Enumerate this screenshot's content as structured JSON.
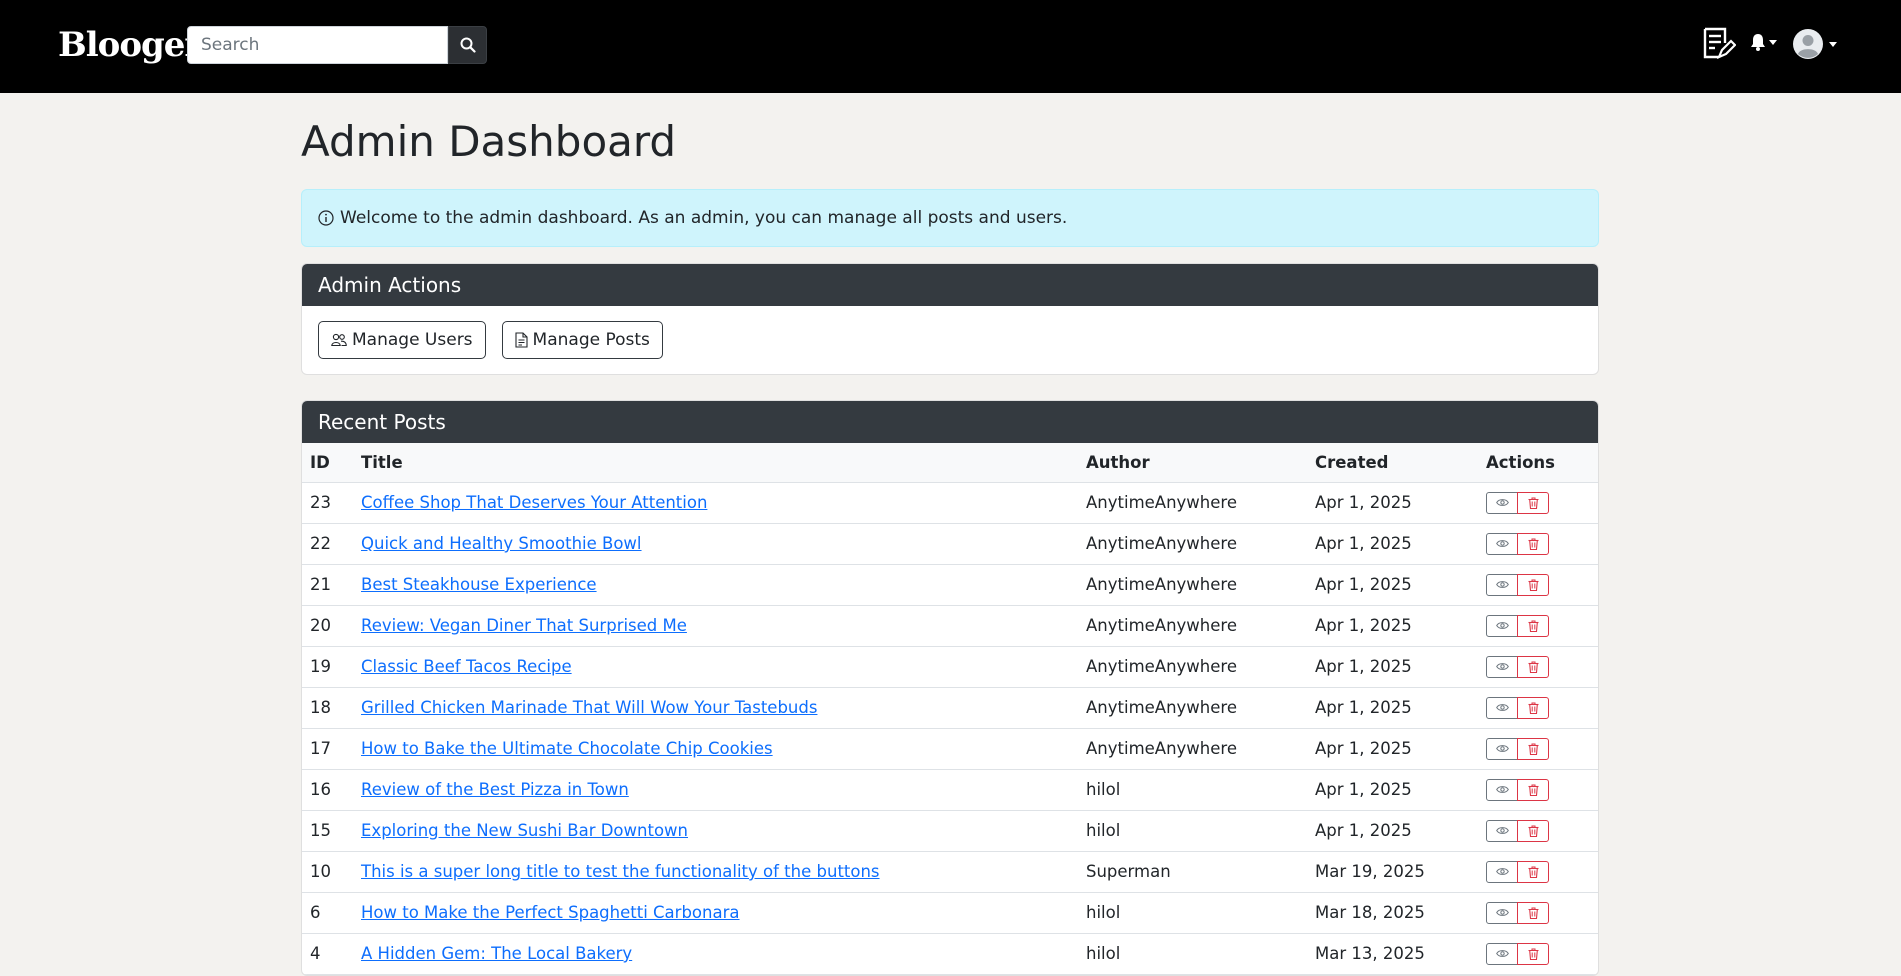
{
  "navbar": {
    "brand": "Blooger.",
    "search_placeholder": "Search",
    "icons": {
      "search": "search-icon",
      "write": "write-post-icon",
      "bell": "bell-icon",
      "avatar": "avatar-icon"
    }
  },
  "page": {
    "title": "Admin Dashboard",
    "alert_text": "Welcome to the admin dashboard. As an admin, you can manage all posts and users."
  },
  "admin_actions": {
    "header": "Admin Actions",
    "manage_users": "Manage Users",
    "manage_posts": "Manage Posts"
  },
  "recent_posts": {
    "header": "Recent Posts",
    "columns": [
      "ID",
      "Title",
      "Author",
      "Created",
      "Actions"
    ],
    "rows": [
      {
        "id": "23",
        "title": "Coffee Shop That Deserves Your Attention",
        "author": "AnytimeAnywhere",
        "created": "Apr 1, 2025"
      },
      {
        "id": "22",
        "title": "Quick and Healthy Smoothie Bowl",
        "author": "AnytimeAnywhere",
        "created": "Apr 1, 2025"
      },
      {
        "id": "21",
        "title": "Best Steakhouse Experience",
        "author": "AnytimeAnywhere",
        "created": "Apr 1, 2025"
      },
      {
        "id": "20",
        "title": "Review: Vegan Diner That Surprised Me",
        "author": "AnytimeAnywhere",
        "created": "Apr 1, 2025"
      },
      {
        "id": "19",
        "title": "Classic Beef Tacos Recipe",
        "author": "AnytimeAnywhere",
        "created": "Apr 1, 2025"
      },
      {
        "id": "18",
        "title": "Grilled Chicken Marinade That Will Wow Your Tastebuds",
        "author": "AnytimeAnywhere",
        "created": "Apr 1, 2025"
      },
      {
        "id": "17",
        "title": "How to Bake the Ultimate Chocolate Chip Cookies",
        "author": "AnytimeAnywhere",
        "created": "Apr 1, 2025"
      },
      {
        "id": "16",
        "title": "Review of the Best Pizza in Town",
        "author": "hilol",
        "created": "Apr 1, 2025"
      },
      {
        "id": "15",
        "title": "Exploring the New Sushi Bar Downtown",
        "author": "hilol",
        "created": "Apr 1, 2025"
      },
      {
        "id": "10",
        "title": "This is a super long title to test the functionality of the buttons",
        "author": "Superman",
        "created": "Mar 19, 2025"
      },
      {
        "id": "6",
        "title": "How to Make the Perfect Spaghetti Carbonara",
        "author": "hilol",
        "created": "Mar 18, 2025"
      },
      {
        "id": "4",
        "title": "A Hidden Gem: The Local Bakery",
        "author": "hilol",
        "created": "Mar 13, 2025"
      }
    ]
  },
  "colors": {
    "navbar": "#000000",
    "card_header": "#343a40",
    "alert_bg": "#cff4fc",
    "link": "#0d6efd",
    "delete": "#dc3545"
  }
}
